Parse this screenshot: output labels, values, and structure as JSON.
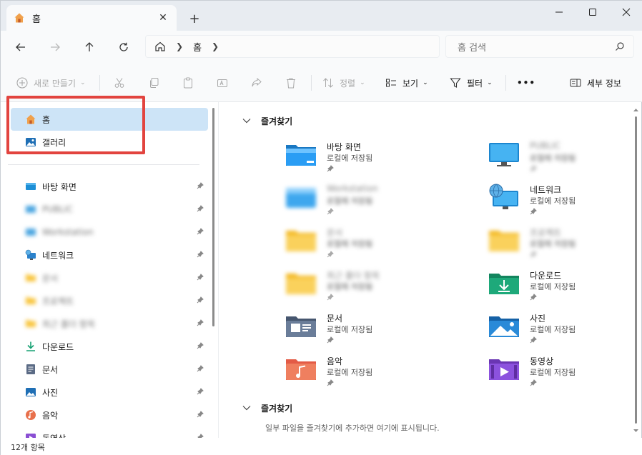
{
  "titlebar": {
    "tab_title": "홈",
    "close_glyph": "✕",
    "new_tab_glyph": "+",
    "minimize_glyph": "—",
    "maximize_glyph": "☐",
    "close_window_glyph": "✕"
  },
  "navigation": {
    "breadcrumb": [
      "홈"
    ],
    "search_placeholder": "홈 검색"
  },
  "commandbar": {
    "new_label": "새로 만들기",
    "sort_label": "정렬",
    "view_label": "보기",
    "filter_label": "필터",
    "more_label": "•••",
    "details_label": "세부 정보"
  },
  "sidebar": {
    "top_items": [
      {
        "label": "홈",
        "icon": "home-icon",
        "selected": true
      },
      {
        "label": "갤러리",
        "icon": "gallery-icon",
        "selected": false
      }
    ],
    "pinned_items": [
      {
        "label": "바탕 화면",
        "icon": "desktop-icon"
      },
      {
        "label": "PUBLIC",
        "icon": "pc-icon",
        "blurred": true
      },
      {
        "label": "Workstation",
        "icon": "pc-icon",
        "blurred": true
      },
      {
        "label": "네트워크",
        "icon": "network-icon"
      },
      {
        "label": "문서",
        "icon": "folder-icon",
        "blurred": true
      },
      {
        "label": "프로젝트",
        "icon": "folder-icon",
        "blurred": true
      },
      {
        "label": "최근 폴더 항목",
        "icon": "folder-icon",
        "blurred": true
      },
      {
        "label": "다운로드",
        "icon": "download-icon"
      },
      {
        "label": "문서",
        "icon": "documents-icon"
      },
      {
        "label": "사진",
        "icon": "pictures-icon"
      },
      {
        "label": "음악",
        "icon": "music-icon"
      },
      {
        "label": "동영상",
        "icon": "videos-icon"
      }
    ]
  },
  "content": {
    "group1_title": "즐겨찾기",
    "tiles": [
      {
        "name": "바탕 화면",
        "sub": "로컬에 저장됨",
        "icon": "desktop-folder-icon",
        "blurred": false
      },
      {
        "name": "PUBLIC",
        "sub": "로컬에 저장됨",
        "icon": "monitor-icon",
        "blurred": true
      },
      {
        "name": "Workstation",
        "sub": "로컬에 저장됨",
        "icon": "pc-folder-icon",
        "blurred": true
      },
      {
        "name": "네트워크",
        "sub": "로컬에 저장됨",
        "icon": "network-icon",
        "blurred": false
      },
      {
        "name": "문서",
        "sub": "로컬에 저장됨",
        "icon": "folder-icon",
        "blurred": true
      },
      {
        "name": "프로젝트",
        "sub": "로컬에 저장됨",
        "icon": "folder-icon",
        "blurred": true
      },
      {
        "name": "최근 폴더 항목",
        "sub": "로컬에 저장됨",
        "icon": "folder-icon",
        "blurred": true
      },
      {
        "name": "다운로드",
        "sub": "로컬에 저장됨",
        "icon": "download-folder-icon",
        "blurred": false
      },
      {
        "name": "문서",
        "sub": "로컬에 저장됨",
        "icon": "documents-folder-icon",
        "blurred": false
      },
      {
        "name": "사진",
        "sub": "로컬에 저장됨",
        "icon": "pictures-folder-icon",
        "blurred": false
      },
      {
        "name": "음악",
        "sub": "로컬에 저장됨",
        "icon": "music-folder-icon",
        "blurred": false
      },
      {
        "name": "동영상",
        "sub": "로컬에 저장됨",
        "icon": "videos-folder-icon",
        "blurred": false
      }
    ],
    "group2_title": "즐겨찾기",
    "group2_empty_message": "일부 파일을 즐겨찾기에 추가하면 여기에 표시됩니다."
  },
  "statusbar": {
    "item_count": "12개 항목"
  },
  "colors": {
    "accent": "#0067c0",
    "selection": "#cde4f7",
    "annotation": "#e2443f",
    "folder_yellow": "#f8c43b"
  }
}
